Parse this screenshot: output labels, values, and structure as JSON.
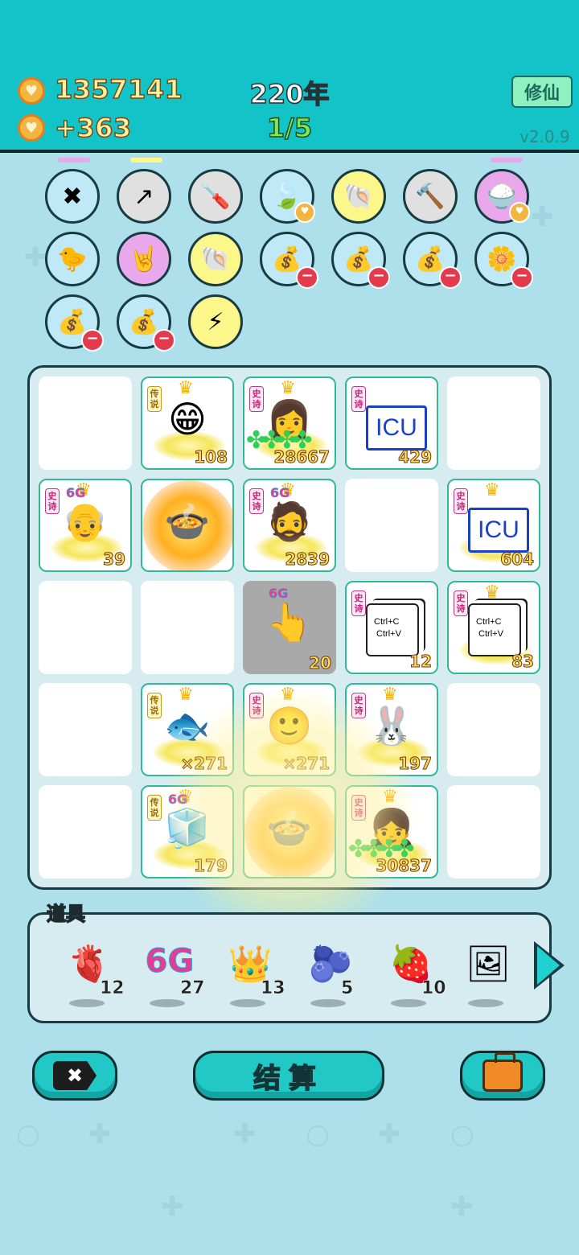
{
  "header": {
    "coins": "1357141",
    "income": "+363",
    "year": "220年",
    "progress": "1/5",
    "xiuxian_label": "修仙",
    "version": "v2.0.9"
  },
  "relics": [
    {
      "icon": "crossed-sticks-icon",
      "glyph": "✖",
      "bg": "#bfe9f6",
      "badge": ""
    },
    {
      "icon": "growth-arrow-card-icon",
      "glyph": "↗",
      "bg": "#e0e0e0",
      "badge": ""
    },
    {
      "icon": "screwdriver-icon",
      "glyph": "🪛",
      "bg": "#e0e0e0",
      "badge": ""
    },
    {
      "icon": "leaf-icon",
      "glyph": "🍃",
      "bg": "#bfe9f6",
      "badge": "heart"
    },
    {
      "icon": "shell-icon",
      "glyph": "🐚",
      "bg": "#fbf78a",
      "badge": ""
    },
    {
      "icon": "hammer-icon",
      "glyph": "🔨",
      "bg": "#e0e0e0",
      "badge": ""
    },
    {
      "icon": "rice-bowl-icon",
      "glyph": "🍚",
      "bg": "#e9a8ec",
      "badge": "heart"
    },
    {
      "icon": "chick-egg-icon",
      "glyph": "🐤",
      "bg": "#bfe9f6",
      "badge": ""
    },
    {
      "icon": "rock-hand-icon",
      "glyph": "🤘",
      "bg": "#e9a8ec",
      "badge": ""
    },
    {
      "icon": "shell-icon",
      "glyph": "🐚",
      "bg": "#fbf78a",
      "badge": ""
    },
    {
      "icon": "sack-icon",
      "glyph": "💰",
      "bg": "#bfe9f6",
      "badge": "minus"
    },
    {
      "icon": "sack-icon",
      "glyph": "💰",
      "bg": "#bfe9f6",
      "badge": "minus"
    },
    {
      "icon": "sack-icon",
      "glyph": "💰",
      "bg": "#bfe9f6",
      "badge": "minus"
    },
    {
      "icon": "potted-flower-icon",
      "glyph": "🌼",
      "bg": "#bfe9f6",
      "badge": "minus"
    },
    {
      "icon": "sack-icon",
      "glyph": "💰",
      "bg": "#bfe9f6",
      "badge": "minus"
    },
    {
      "icon": "sack-icon",
      "glyph": "💰",
      "bg": "#bfe9f6",
      "badge": "minus"
    },
    {
      "icon": "lightning-icon",
      "glyph": "⚡",
      "bg": "#fbf78a",
      "badge": ""
    }
  ],
  "board": {
    "cells": [
      {
        "r": 0,
        "c": 0,
        "empty": true
      },
      {
        "r": 0,
        "c": 1,
        "tag": "传说",
        "tag_type": "legend",
        "crown": true,
        "icon": "grinning-glasses-man",
        "glyph": "😁",
        "num": "108",
        "ring": true
      },
      {
        "r": 0,
        "c": 2,
        "tag": "史诗",
        "tag_type": "epic",
        "crown": true,
        "icon": "long-hair-face-with-clovers",
        "glyph": "👩",
        "num": "28667",
        "ring": true,
        "clovers": true
      },
      {
        "r": 0,
        "c": 3,
        "tag": "史诗",
        "tag_type": "epic",
        "icon": "icu-sign",
        "icu": true,
        "num": "429"
      },
      {
        "r": 0,
        "c": 4,
        "empty": true
      },
      {
        "r": 1,
        "c": 0,
        "tag": "史诗",
        "tag_type": "epic",
        "crown": true,
        "gg": "6G",
        "icon": "old-man-hat",
        "glyph": "👴",
        "num": "39",
        "ring": true
      },
      {
        "r": 1,
        "c": 1,
        "icon": "pressure-cooker-fire",
        "glyph": "🍲",
        "fire": true
      },
      {
        "r": 1,
        "c": 2,
        "tag": "史诗",
        "tag_type": "epic",
        "crown": true,
        "gg": "6G",
        "icon": "bald-beard-man",
        "glyph": "🧔",
        "num": "2839",
        "ring": true
      },
      {
        "r": 1,
        "c": 3,
        "empty": true
      },
      {
        "r": 1,
        "c": 4,
        "tag": "史诗",
        "tag_type": "epic",
        "crown": true,
        "icon": "icu-sign",
        "icu": true,
        "num": "604",
        "ring": true
      },
      {
        "r": 2,
        "c": 0,
        "empty": true
      },
      {
        "r": 2,
        "c": 1,
        "empty": true
      },
      {
        "r": 2,
        "c": 2,
        "gray": true,
        "gg": "6G",
        "icon": "pointing-hand",
        "glyph": "👆",
        "num": "20"
      },
      {
        "r": 2,
        "c": 3,
        "tag": "史诗",
        "tag_type": "epic",
        "icon": "copy-paste-cards",
        "ctrl": true,
        "num": "12"
      },
      {
        "r": 2,
        "c": 4,
        "tag": "史诗",
        "tag_type": "epic",
        "crown": true,
        "icon": "copy-paste-cards",
        "ctrl": true,
        "num": "83",
        "ring": true
      },
      {
        "r": 3,
        "c": 0,
        "empty": true
      },
      {
        "r": 3,
        "c": 1,
        "tag": "传说",
        "tag_type": "legend",
        "crown": true,
        "icon": "lucky-fish",
        "glyph": "🐟",
        "num": "×271",
        "ring": true
      },
      {
        "r": 3,
        "c": 2,
        "tag": "史诗",
        "tag_type": "epic",
        "crown": true,
        "icon": "face-with-heart",
        "glyph": "🙂",
        "num": "×271",
        "ring": true
      },
      {
        "r": 3,
        "c": 3,
        "tag": "史诗",
        "tag_type": "epic",
        "crown": true,
        "icon": "rabbit-house",
        "glyph": "🐰",
        "num": "197",
        "ring": true
      },
      {
        "r": 3,
        "c": 4,
        "empty": true
      },
      {
        "r": 4,
        "c": 0,
        "empty": true
      },
      {
        "r": 4,
        "c": 1,
        "tag": "传说",
        "tag_type": "legend",
        "crown": true,
        "gg": "6G",
        "icon": "fridge",
        "glyph": "🧊",
        "num": "179",
        "ring": true
      },
      {
        "r": 4,
        "c": 2,
        "icon": "pot-fire",
        "glyph": "🍲",
        "fire": true
      },
      {
        "r": 4,
        "c": 3,
        "tag": "史诗",
        "tag_type": "epic",
        "crown": true,
        "icon": "girl-with-clovers",
        "glyph": "👧",
        "num": "30837",
        "ring": true,
        "clovers": true
      },
      {
        "r": 4,
        "c": 4,
        "empty": true
      }
    ]
  },
  "items": {
    "label": "道具",
    "list": [
      {
        "icon": "liver-icon",
        "glyph": "🫀",
        "count": "12"
      },
      {
        "icon": "6g-icon",
        "text": "6G",
        "count": "27"
      },
      {
        "icon": "crown-icon",
        "glyph": "👑",
        "count": "13"
      },
      {
        "icon": "blueberry-icon",
        "glyph": "🫐",
        "count": "5"
      },
      {
        "icon": "strawberry-icon",
        "glyph": "🍓",
        "count": "10"
      },
      {
        "icon": "framed-eggs-icon",
        "glyph": "🖼",
        "count": ""
      }
    ]
  },
  "buttons": {
    "exit_glyph": "✖",
    "settle_label": "结算"
  }
}
